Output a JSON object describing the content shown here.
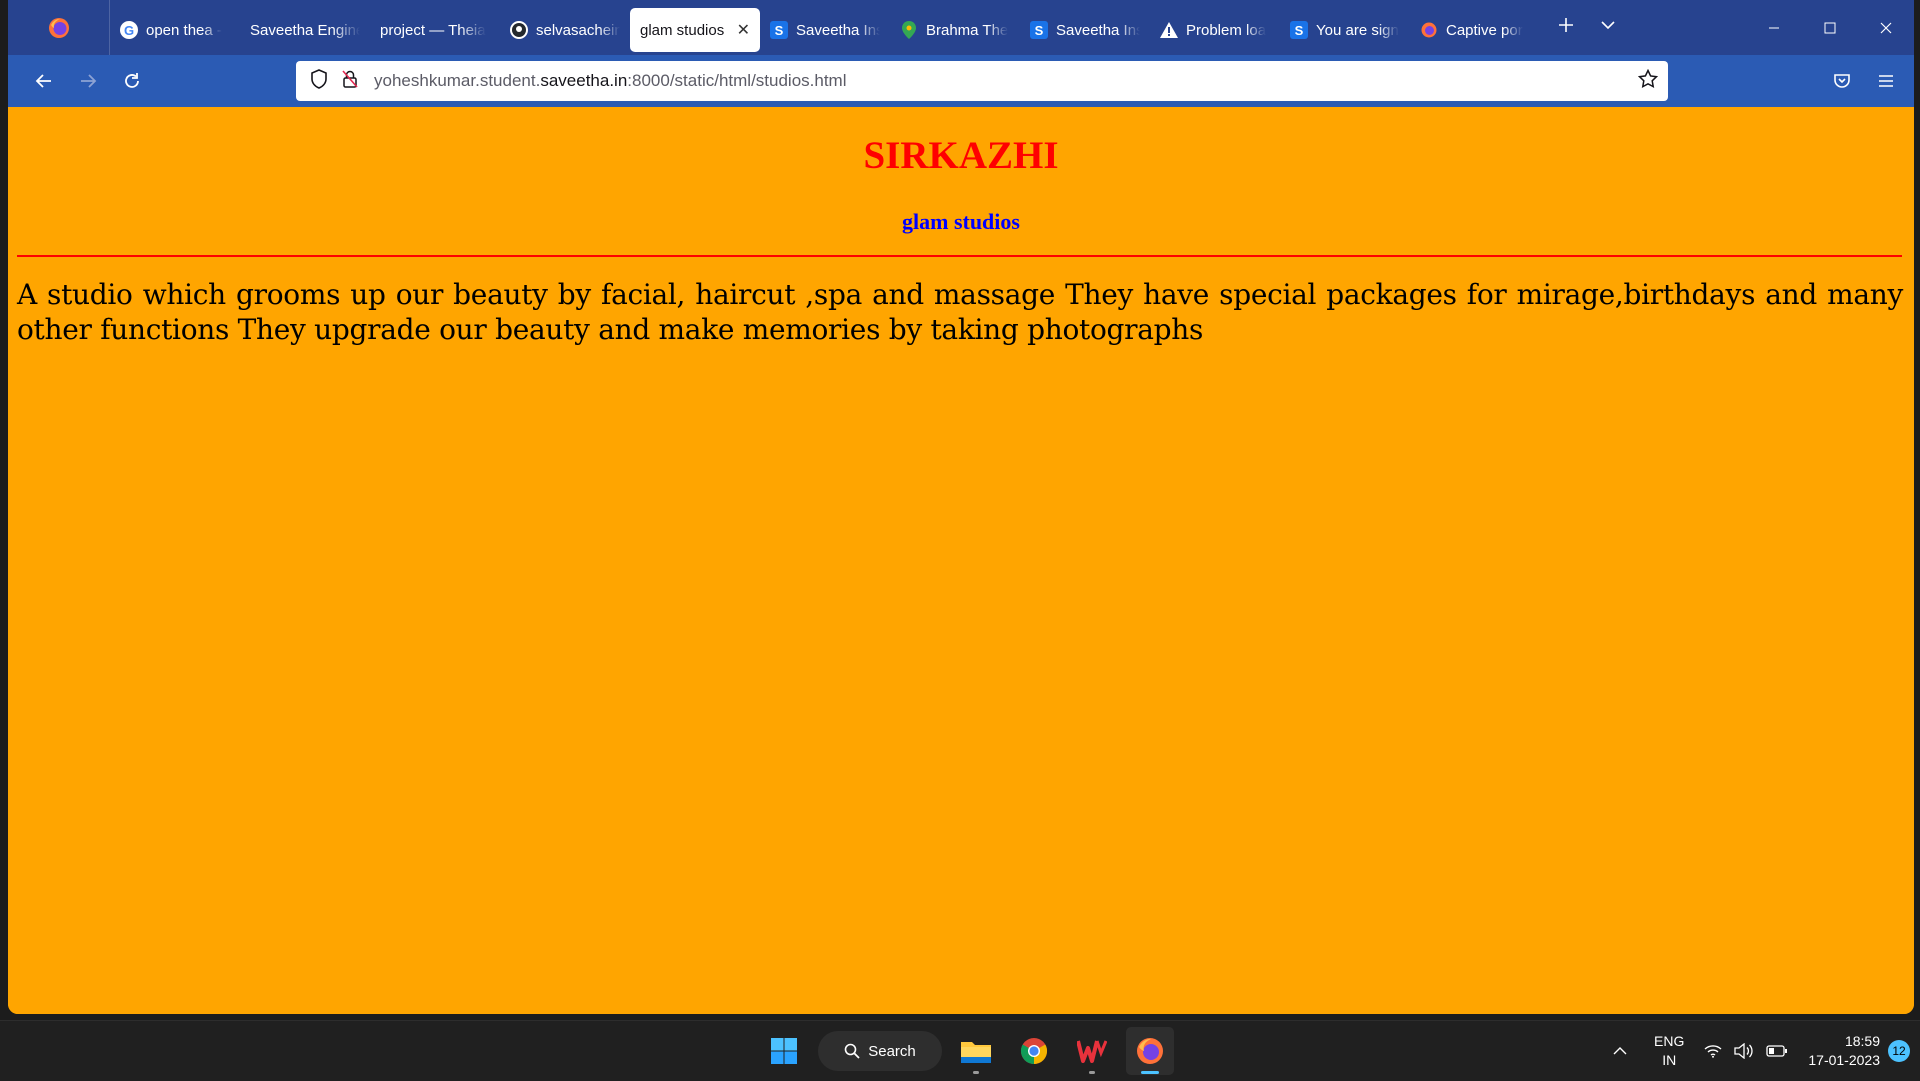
{
  "browser": {
    "tabs": [
      {
        "label": "open thea -",
        "icon": "google-icon"
      },
      {
        "label": "Saveetha Engine",
        "icon": "none"
      },
      {
        "label": "project — Theia",
        "icon": "none"
      },
      {
        "label": "selvasachein",
        "icon": "github-icon"
      },
      {
        "label": "glam studios",
        "icon": "none",
        "active": true
      },
      {
        "label": "Saveetha Ins",
        "icon": "saveetha-icon"
      },
      {
        "label": "Brahma The",
        "icon": "maps-pin-icon"
      },
      {
        "label": "Saveetha Ins",
        "icon": "saveetha-icon"
      },
      {
        "label": "Problem loa",
        "icon": "warning-icon"
      },
      {
        "label": "You are sign",
        "icon": "saveetha-icon"
      },
      {
        "label": "Captive por",
        "icon": "firefox-icon"
      }
    ],
    "url_prefix": "yoheshkumar.student.",
    "url_domain": "saveetha.in",
    "url_suffix": ":8000/static/html/studios.html",
    "accent_colors": {
      "tabstrip": "#27438f",
      "navbar": "#2b5bb4"
    }
  },
  "page": {
    "heading": "SIRKAZHI",
    "subheading": "glam studios",
    "paragraph": "A studio which grooms up our beauty by facial, haircut ,spa and massage They have special packages for mirage,birthdays and many other functions They upgrade our beauty and make memories by taking photographs",
    "colors": {
      "background": "#ffa500",
      "heading": "#ff0000",
      "subheading": "#0000ff",
      "rule": "#ff0000"
    }
  },
  "taskbar": {
    "search_label": "Search",
    "language_line1": "ENG",
    "language_line2": "IN",
    "time": "18:59",
    "date": "17-01-2023",
    "notification_count": "12"
  }
}
